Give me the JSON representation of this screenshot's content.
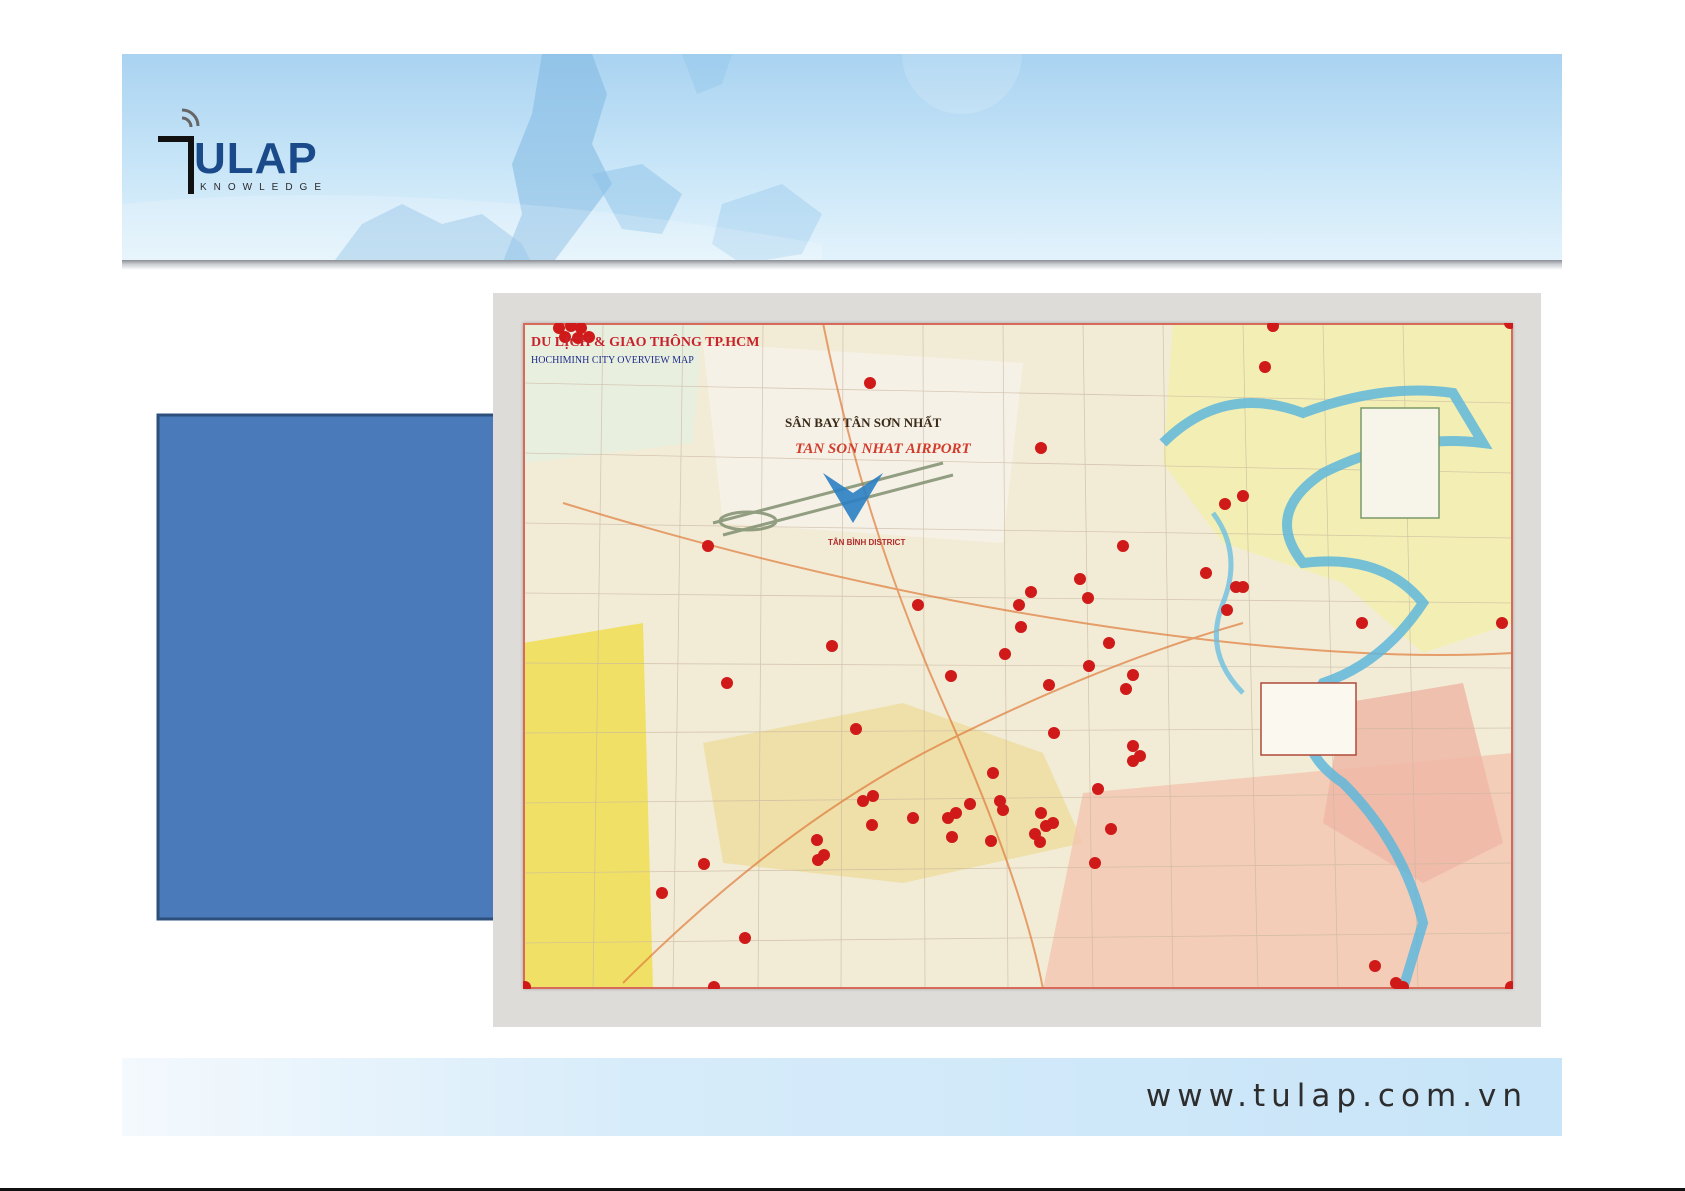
{
  "brand": {
    "logo_text": "ULAP",
    "logo_subtext": "KNOWLEDGE"
  },
  "map": {
    "title": "DU LỊCH & GIAO THÔNG TP.HCM",
    "subtitle": "HOCHIMINH CITY OVERVIEW MAP",
    "airport_label": "SÂN BAY TÂN SƠN NHẤT",
    "airport_label_en": "TAN SON NHAT AIRPORT",
    "district_label": "TÂN BÌNH DISTRICT",
    "pin_color": "#d01a1a"
  },
  "callout": {
    "fill_color": "#4a7ab9",
    "stroke_color": "#2c4f7c"
  },
  "footer": {
    "url": "www.tulap.com.vn"
  }
}
